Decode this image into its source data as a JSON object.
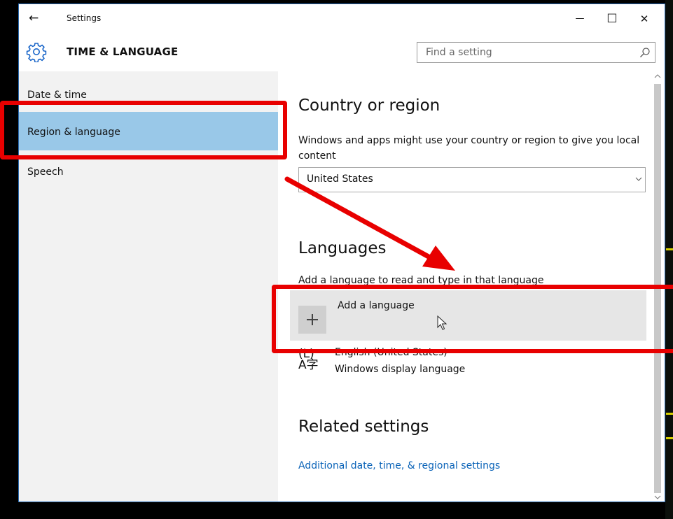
{
  "window": {
    "app_title": "Settings",
    "back_glyph": "←",
    "controls": {
      "minimize": "—",
      "maximize": "☐",
      "close": "✕"
    }
  },
  "header": {
    "icon": "gear-icon",
    "title": "TIME & LANGUAGE",
    "search_placeholder": "Find a setting",
    "search_icon": "search-icon"
  },
  "sidebar": {
    "items": [
      {
        "label": "Date & time",
        "selected": false
      },
      {
        "label": "Region & language",
        "selected": true
      },
      {
        "label": "Speech",
        "selected": false
      }
    ]
  },
  "content": {
    "country": {
      "heading": "Country or region",
      "description": "Windows and apps might use your country or region to give you local content",
      "selected": "United States"
    },
    "languages": {
      "heading": "Languages",
      "description": "Add a language to read and type in that language",
      "add_label": "Add a language",
      "items": [
        {
          "name": "English (United States)",
          "subtitle": "Windows display language",
          "icon": "language-glyph-icon"
        }
      ]
    },
    "related": {
      "heading": "Related settings",
      "link": "Additional date, time, & regional settings"
    }
  },
  "colors": {
    "selected_nav": "#99c8e8",
    "link": "#0a63b8",
    "annotation": "#e80000",
    "window_border": "#2b6cb3"
  }
}
